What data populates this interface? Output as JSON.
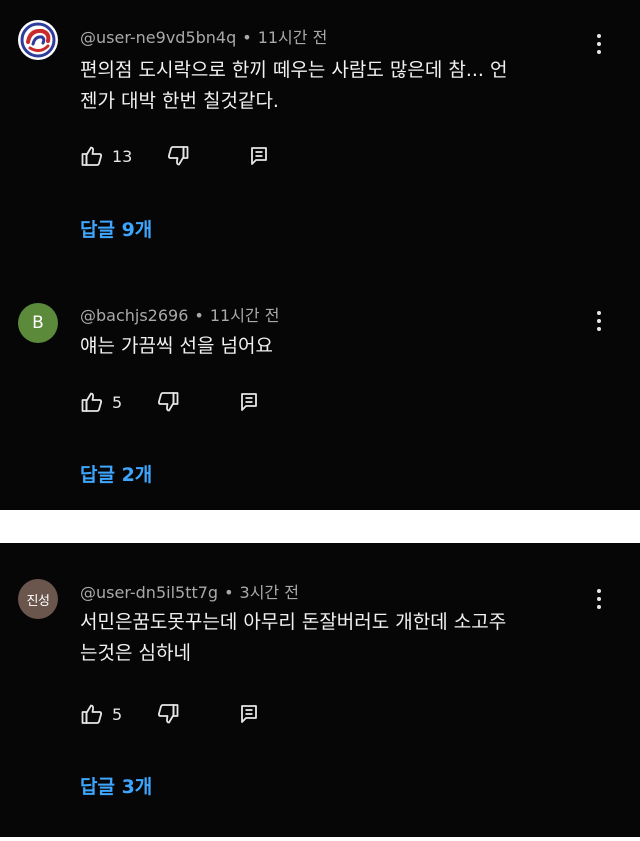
{
  "comments": [
    {
      "username": "@user-ne9vd5bn4q",
      "time": "11시간 전",
      "avatar_text": "",
      "text_line1": "편의점 도시락으로 한끼 떼우는 사람도 많은데 참... 언",
      "text_line2": "젠가 대박 한번 칠것같다.",
      "likes": "13",
      "replies": "답글 9개"
    },
    {
      "username": "@bachjs2696",
      "time": "11시간 전",
      "avatar_text": "B",
      "text_line1": "얘는 가끔씩 선을 넘어요",
      "text_line2": "",
      "likes": "5",
      "replies": "답글 2개"
    },
    {
      "username": "@user-dn5il5tt7g",
      "time": "3시간 전",
      "avatar_text": "진성",
      "text_line1": "서민은꿈도못꾸는데 아무리 돈잘버러도 개한데 소고주",
      "text_line2": "는것은 심하네",
      "likes": "5",
      "replies": "답글 3개"
    }
  ],
  "meta_separator": "•",
  "colors": {
    "background": "#060606",
    "text": "#f1f1f1",
    "meta": "#a9a9a9",
    "link": "#3ea6ff"
  },
  "icons": [
    "thumbs-up-icon",
    "thumbs-down-icon",
    "reply-icon",
    "more-vert-icon"
  ]
}
